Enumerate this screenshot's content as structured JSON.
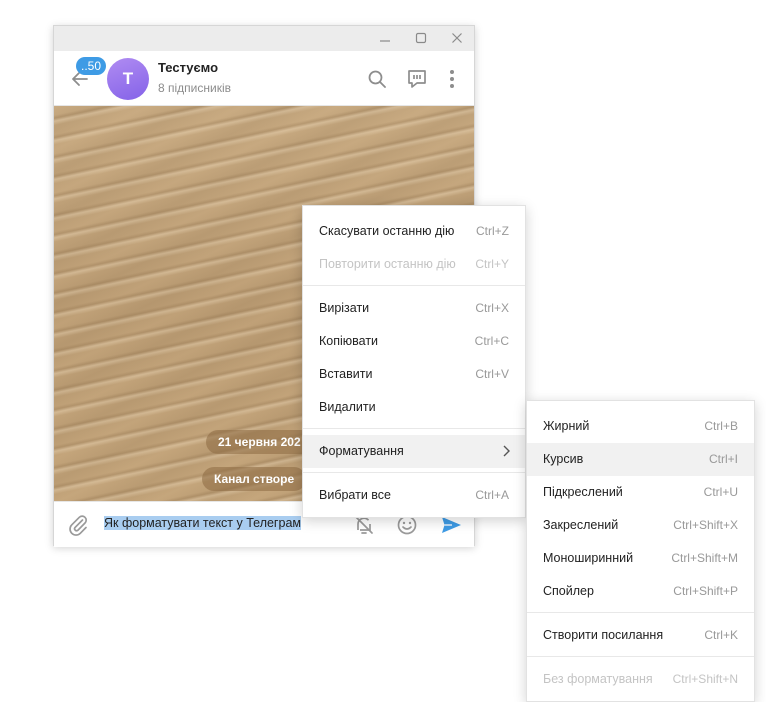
{
  "window": {
    "minimize_icon": "minimize-icon",
    "maximize_icon": "maximize-icon",
    "close_icon": "close-icon"
  },
  "header": {
    "unread_count": "..50",
    "avatar_letter": "Т",
    "title": "Тестуємо",
    "subtitle": "8 підписників",
    "icons": [
      "search-icon",
      "discussion-icon",
      "more-icon"
    ]
  },
  "chat": {
    "date_pill": "21 червня 202",
    "service_pill": "Канал створе"
  },
  "composer": {
    "message": "Як форматувати текст у Телеграм",
    "icons": [
      "attach-icon",
      "mute-icon",
      "emoji-icon",
      "send-icon"
    ]
  },
  "context_menu": {
    "items": [
      {
        "label": "Скасувати останню дію",
        "shortcut": "Ctrl+Z"
      },
      {
        "label": "Повторити останню дію",
        "shortcut": "Ctrl+Y"
      },
      {
        "label": "Вирізати",
        "shortcut": "Ctrl+X"
      },
      {
        "label": "Копіювати",
        "shortcut": "Ctrl+C"
      },
      {
        "label": "Вставити",
        "shortcut": "Ctrl+V"
      },
      {
        "label": "Видалити",
        "shortcut": ""
      },
      {
        "label": "Форматування",
        "shortcut": ""
      },
      {
        "label": "Вибрати все",
        "shortcut": "Ctrl+A"
      }
    ]
  },
  "format_submenu": {
    "items": [
      {
        "label": "Жирний",
        "shortcut": "Ctrl+B"
      },
      {
        "label": "Курсив",
        "shortcut": "Ctrl+I"
      },
      {
        "label": "Підкреслений",
        "shortcut": "Ctrl+U"
      },
      {
        "label": "Закреслений",
        "shortcut": "Ctrl+Shift+X"
      },
      {
        "label": "Моноширинний",
        "shortcut": "Ctrl+Shift+M"
      },
      {
        "label": "Спойлер",
        "shortcut": "Ctrl+Shift+P"
      },
      {
        "label": "Створити посилання",
        "shortcut": "Ctrl+K"
      },
      {
        "label": "Без форматування",
        "shortcut": "Ctrl+Shift+N"
      }
    ]
  },
  "colors": {
    "accent": "#3e9be5",
    "avatar_gradient": [
      "#b08cf2",
      "#8462e8"
    ],
    "selection": "#a9cdf0",
    "menu_highlight": "#f1f1f1"
  }
}
